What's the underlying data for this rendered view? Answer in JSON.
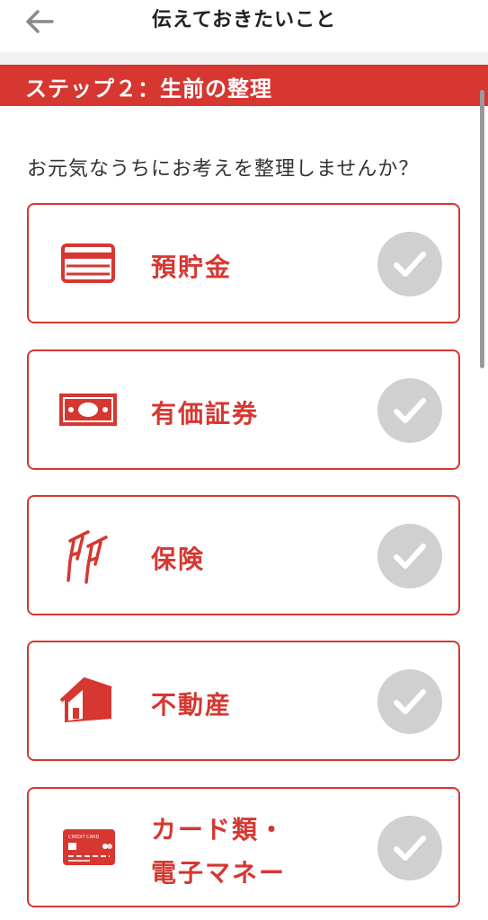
{
  "header": {
    "title": "伝えておきたいこと",
    "back_icon": "arrow-left-icon"
  },
  "step": {
    "label": "ステップ２：生前の整理"
  },
  "prompt": "お元気なうちにお考えを整理しませんか？",
  "colors": {
    "accent": "#d63731",
    "check_bg": "#d0d0d0",
    "check_mark": "#ffffff"
  },
  "items": [
    {
      "label": "預貯金",
      "icon": "bankbook-icon",
      "checked": false
    },
    {
      "label": "有価証券",
      "icon": "banknote-icon",
      "checked": false
    },
    {
      "label": "保険",
      "icon": "crutches-icon",
      "checked": false
    },
    {
      "label": "不動産",
      "icon": "house-icon",
      "checked": false
    },
    {
      "label": "カード類・\n電子マネー",
      "icon": "credit-card-icon",
      "card_text": "CREDIT CARD",
      "checked": false
    }
  ]
}
